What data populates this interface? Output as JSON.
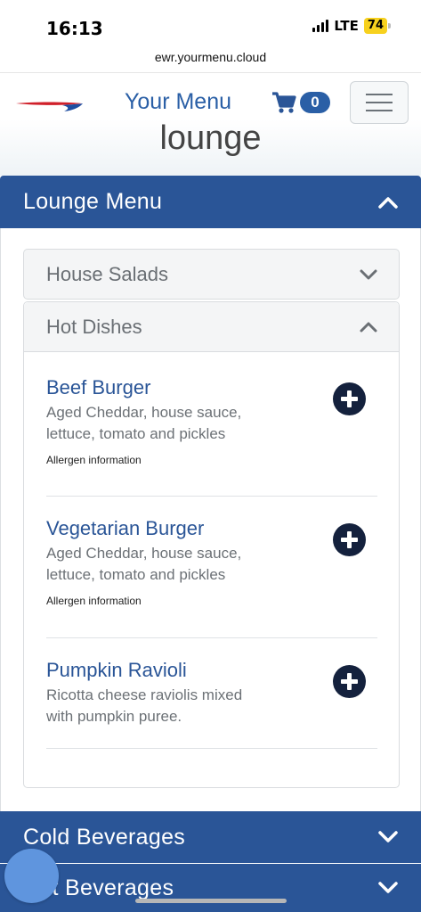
{
  "status_bar": {
    "time": "16:13",
    "network": "LTE",
    "battery": "74"
  },
  "browser": {
    "url": "ewr.yourmenu.cloud"
  },
  "header": {
    "brand_title": "Your Menu",
    "cart_count": "0",
    "page_title": "lounge"
  },
  "lounge_menu": {
    "label": "Lounge Menu",
    "categories": [
      {
        "title": "House Salads",
        "state": "collapsed"
      },
      {
        "title": "Hot Dishes",
        "state": "expanded"
      }
    ],
    "hot_dishes": [
      {
        "name": "Beef Burger",
        "desc_line1": "Aged Cheddar, house sauce,",
        "desc_line2": "lettuce, tomato and pickles",
        "allergen": "Allergen information"
      },
      {
        "name": "Vegetarian Burger",
        "desc_line1": "Aged Cheddar, house sauce,",
        "desc_line2": "lettuce, tomato and pickles",
        "allergen": "Allergen information"
      },
      {
        "name": "Pumpkin Ravioli",
        "desc_line1": "Ricotta cheese raviolis mixed",
        "desc_line2": "with pumpkin puree.",
        "allergen": ""
      }
    ]
  },
  "sections": [
    {
      "label": "Cold Beverages",
      "state": "collapsed"
    },
    {
      "label": "Hot Beverages",
      "state": "collapsed"
    }
  ],
  "colors": {
    "brand_blue": "#2a5597",
    "add_button": "#14213d",
    "battery": "#f7d11e"
  },
  "icons": {
    "cart": "cart-icon",
    "menu": "hamburger-icon",
    "add": "plus-circle-icon",
    "expand": "chevron-down-icon",
    "collapse": "chevron-up-icon"
  }
}
